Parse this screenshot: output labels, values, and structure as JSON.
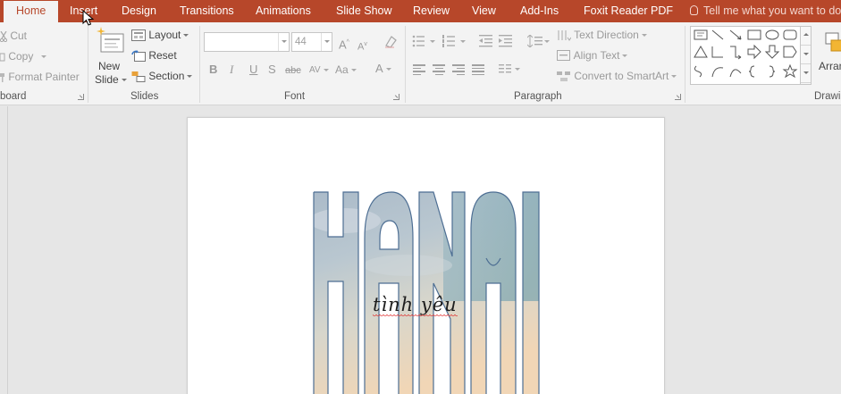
{
  "tabs": [
    {
      "label": "Home",
      "active": true
    },
    {
      "label": "Insert"
    },
    {
      "label": "Design"
    },
    {
      "label": "Transitions"
    },
    {
      "label": "Animations"
    },
    {
      "label": "Slide Show"
    },
    {
      "label": "Review"
    },
    {
      "label": "View"
    },
    {
      "label": "Add-Ins"
    },
    {
      "label": "Foxit Reader PDF"
    }
  ],
  "tell_me": "Tell me what you want to do...",
  "clipboard": {
    "cut": "Cut",
    "copy": "Copy",
    "format_painter": "Format Painter",
    "label": "board"
  },
  "slides": {
    "new_slide_line1": "New",
    "new_slide_line2": "Slide",
    "layout": "Layout",
    "reset": "Reset",
    "section": "Section",
    "label": "Slides"
  },
  "font": {
    "name_value": "",
    "size_value": "44",
    "label": "Font",
    "bold": "B",
    "italic": "I",
    "underline": "U",
    "shadow": "S",
    "strike": "abc",
    "spacing": "AV",
    "change_case": "Aa",
    "font_color": "A",
    "grow": "A",
    "shrink": "A"
  },
  "paragraph": {
    "text_direction": "Text Direction",
    "align_text": "Align Text",
    "convert_smartart": "Convert to SmartArt",
    "label": "Paragraph"
  },
  "drawing": {
    "arrange": "Arran",
    "label": "Drawi"
  },
  "slide_content": {
    "title": "HANOI",
    "tagline": "tình yêu"
  },
  "colors": {
    "accent": "#b7472a",
    "ribbon": "#f3f3f3",
    "workspace": "#e6e6e6"
  }
}
